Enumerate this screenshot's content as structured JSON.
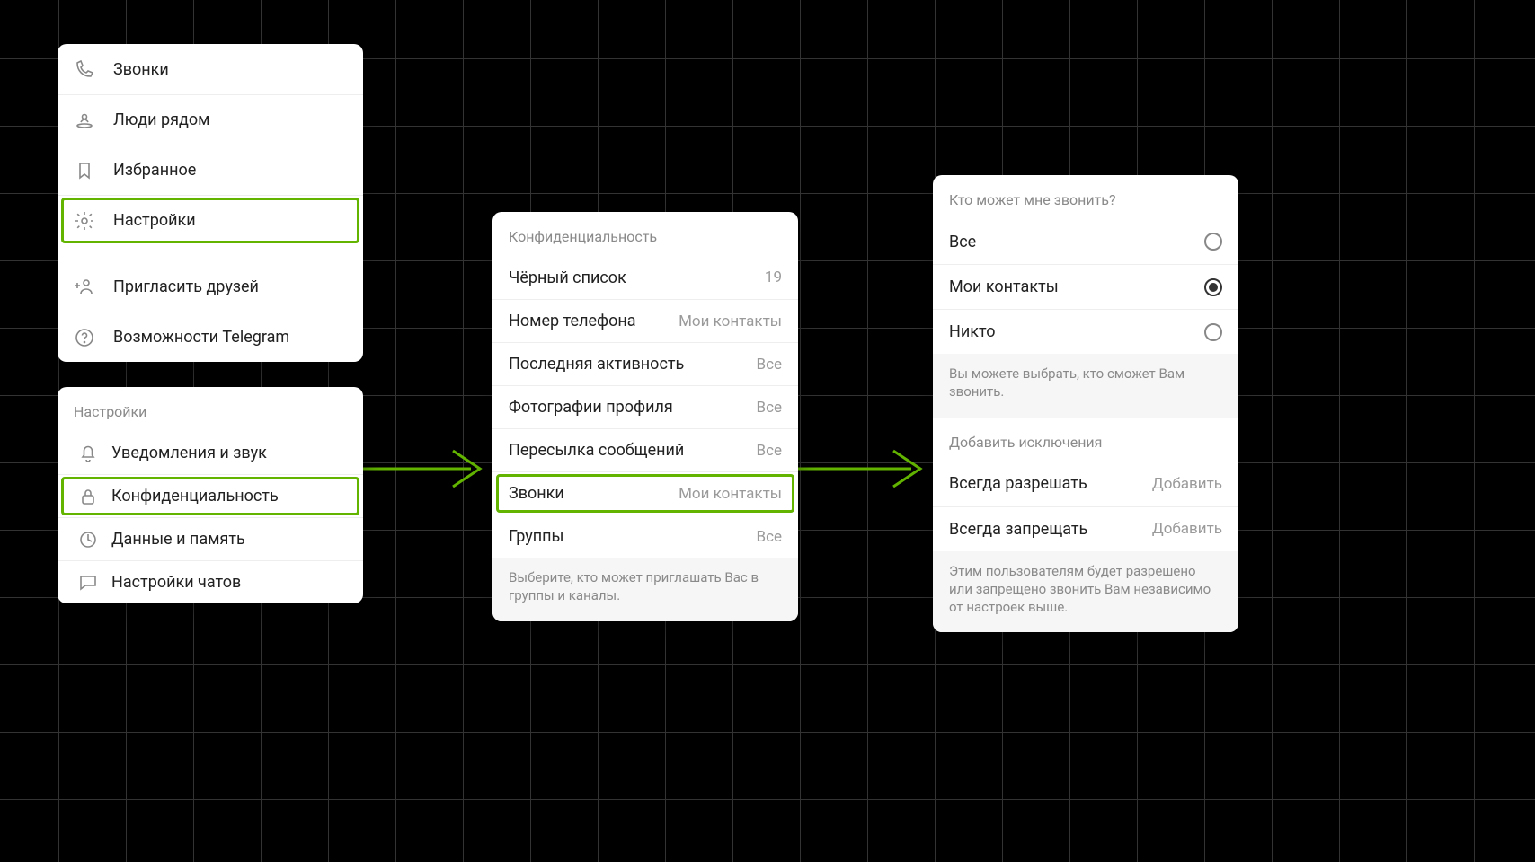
{
  "menu": {
    "items": [
      {
        "id": "calls",
        "label": "Звонки"
      },
      {
        "id": "nearby",
        "label": "Люди рядом"
      },
      {
        "id": "saved",
        "label": "Избранное"
      },
      {
        "id": "settings",
        "label": "Настройки"
      },
      {
        "id": "invite",
        "label": "Пригласить друзей"
      },
      {
        "id": "features",
        "label": "Возможности Telegram"
      }
    ]
  },
  "settings": {
    "header": "Настройки",
    "items": [
      {
        "id": "notif",
        "label": "Уведомления и звук"
      },
      {
        "id": "privacy",
        "label": "Конфиденциальность"
      },
      {
        "id": "data",
        "label": "Данные и память"
      },
      {
        "id": "chat",
        "label": "Настройки чатов"
      }
    ]
  },
  "privacy": {
    "header": "Конфиденциальность",
    "items": [
      {
        "label": "Чёрный список",
        "value": "19"
      },
      {
        "label": "Номер телефона",
        "value": "Мои контакты"
      },
      {
        "label": "Последняя активность",
        "value": "Все"
      },
      {
        "label": "Фотографии профиля",
        "value": "Все"
      },
      {
        "label": "Пересылка сообщений",
        "value": "Все"
      },
      {
        "label": "Звонки",
        "value": "Мои контакты"
      },
      {
        "label": "Группы",
        "value": "Все"
      }
    ],
    "footer": "Выберите, кто может приглашать Вас в группы и каналы."
  },
  "callsCard": {
    "header": "Кто может мне звонить?",
    "options": [
      {
        "label": "Все",
        "selected": false
      },
      {
        "label": "Мои контакты",
        "selected": true
      },
      {
        "label": "Никто",
        "selected": false
      }
    ],
    "note1": "Вы можете выбрать, кто сможет Вам звонить.",
    "excHeader": "Добавить исключения",
    "exc": [
      {
        "label": "Всегда разрешать",
        "action": "Добавить"
      },
      {
        "label": "Всегда запрещать",
        "action": "Добавить"
      }
    ],
    "note2": "Этим пользователям будет разрешено или запрещено звонить Вам независимо от настроек выше."
  },
  "colors": {
    "highlight": "#62b400"
  }
}
